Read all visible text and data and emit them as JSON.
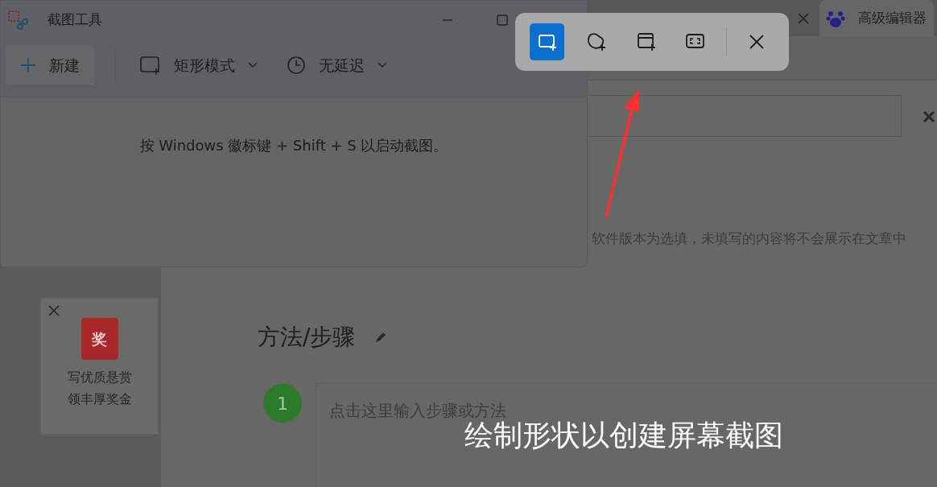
{
  "browser_tabs": [
    {
      "selected": false
    },
    {
      "title": "高级编辑器",
      "selected": true
    }
  ],
  "page": {
    "version_hint": "软件版本为选填，未填写的内容将不会展示在文章中",
    "reward_card": {
      "badge": "奖",
      "lines": [
        "写优质悬赏",
        "领丰厚奖金"
      ]
    },
    "section_title": "方法/步骤",
    "steps": [
      {
        "number": "1",
        "placeholder": "点击这里输入步骤或方法"
      }
    ]
  },
  "snip_window": {
    "title": "截图工具",
    "new_button": "新建",
    "mode": "矩形模式",
    "delay": "无延迟",
    "message": "按 Windows 徽标键 + Shift + S 以启动截图。"
  },
  "snip_toolbar": {
    "modes": [
      {
        "kind": "rectangle",
        "selected": true
      },
      {
        "kind": "freeform",
        "selected": false
      },
      {
        "kind": "window",
        "selected": false
      },
      {
        "kind": "fullscreen",
        "selected": false
      }
    ]
  },
  "overlay_hint": "绘制形状以创建屏幕截图"
}
